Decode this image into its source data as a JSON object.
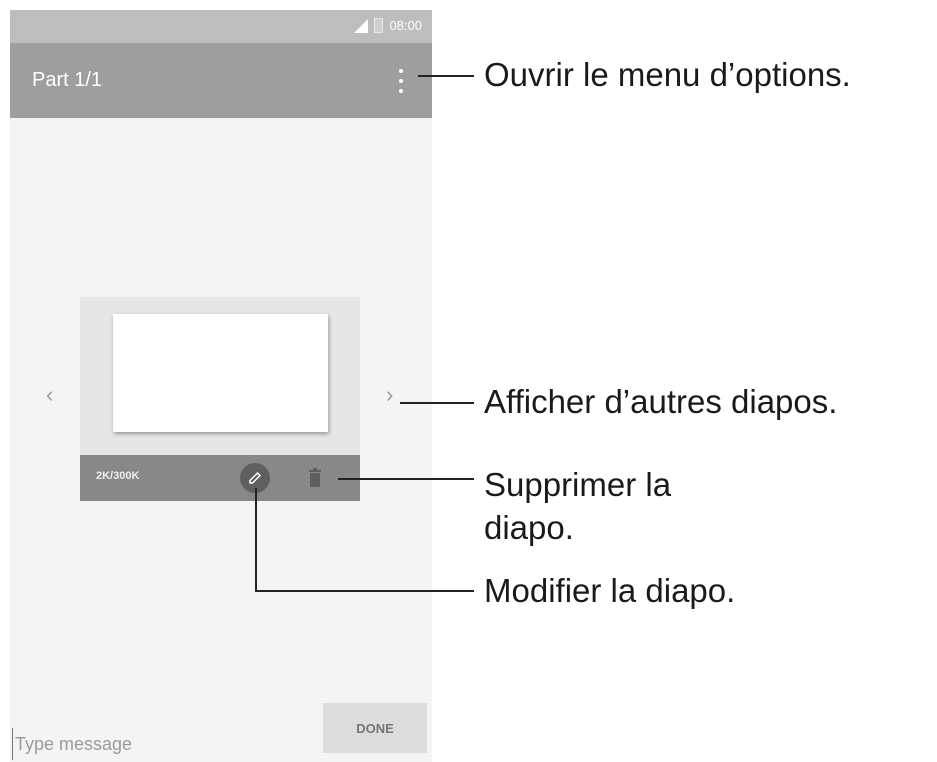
{
  "status_bar": {
    "time": "08:00"
  },
  "app_bar": {
    "title": "Part 1/1"
  },
  "slide": {
    "size": "2K/300K"
  },
  "nav": {
    "prev": "‹",
    "next": "›"
  },
  "composer": {
    "placeholder": "Type message",
    "done_label": "DONE"
  },
  "icons": [
    "signal-icon",
    "battery-icon",
    "overflow-menu-icon",
    "chevron-left-icon",
    "chevron-right-icon",
    "edit-icon",
    "trash-icon"
  ],
  "callouts": {
    "menu": "Ouvrir le menu d’options.",
    "slides": "Afficher d’autres diapos.",
    "delete_line1": "Supprimer la",
    "delete_line2": "diapo.",
    "edit": "Modifier la diapo."
  }
}
